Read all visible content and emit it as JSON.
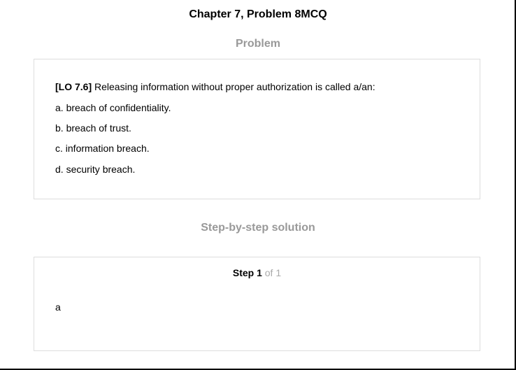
{
  "title": "Chapter 7, Problem 8MCQ",
  "problem": {
    "heading": "Problem",
    "lo_tag": "[LO 7.6]",
    "question_text": "Releasing information without proper authorization is called a/an:",
    "options": [
      "a. breach of confidentiality.",
      "b. breach of trust.",
      "c. information breach.",
      "d. security breach."
    ]
  },
  "solution": {
    "heading": "Step-by-step solution",
    "step_label": "Step 1",
    "step_of": "of 1",
    "answer": "a"
  },
  "colors": {
    "heading_gray": "#999999",
    "step_of_gray": "#aaaaaa",
    "card_border": "#dddddd"
  }
}
